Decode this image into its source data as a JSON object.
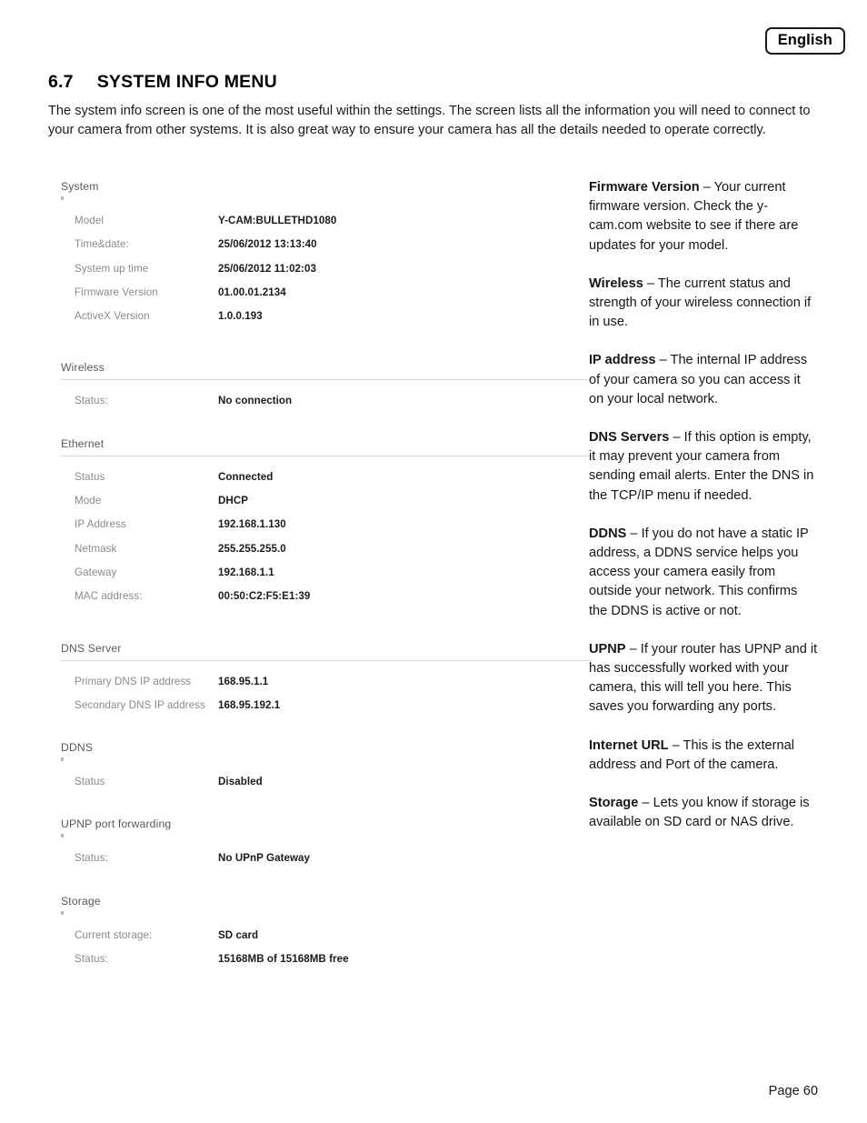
{
  "language_badge": "English",
  "heading": {
    "number": "6.7",
    "title": "SYSTEM INFO MENU"
  },
  "intro": "The system info screen is one of the most useful within the settings.  The screen lists all the information you will need to connect to your camera from other systems. It is also great way to ensure your camera has all the details needed to operate correctly.",
  "screenshot": {
    "sections": [
      {
        "title": "System",
        "rule": false,
        "rows": [
          {
            "label": "Model",
            "value": "Y-CAM:BULLETHD1080"
          },
          {
            "label": "Time&date:",
            "value": "25/06/2012 13:13:40"
          },
          {
            "label": "System up time",
            "value": "25/06/2012 11:02:03"
          },
          {
            "label": "Firmware Version",
            "value": "01.00.01.2134"
          },
          {
            "label": "ActiveX Version",
            "value": "1.0.0.193"
          }
        ]
      },
      {
        "title": "Wireless",
        "rule": true,
        "rows": [
          {
            "label": "Status:",
            "value": "No connection"
          }
        ]
      },
      {
        "title": "Ethernet",
        "rule": true,
        "rows": [
          {
            "label": "Status",
            "value": "Connected"
          },
          {
            "label": "Mode",
            "value": "DHCP"
          },
          {
            "label": "IP Address",
            "value": "192.168.1.130"
          },
          {
            "label": "Netmask",
            "value": "255.255.255.0"
          },
          {
            "label": "Gateway",
            "value": "192.168.1.1"
          },
          {
            "label": "MAC address:",
            "value": "00:50:C2:F5:E1:39"
          }
        ]
      },
      {
        "title": "DNS Server",
        "rule": true,
        "rows": [
          {
            "label": "Primary DNS IP address",
            "value": "168.95.1.1"
          },
          {
            "label": "Secondary DNS IP address",
            "value": "168.95.192.1"
          }
        ]
      },
      {
        "title": "DDNS",
        "rule": false,
        "rows": [
          {
            "label": "Status",
            "value": "Disabled"
          }
        ]
      },
      {
        "title": "UPNP port forwarding",
        "rule": false,
        "rows": [
          {
            "label": "Status:",
            "value": "No UPnP Gateway"
          }
        ]
      },
      {
        "title": "Storage",
        "rule": false,
        "rows": [
          {
            "label": "Current storage:",
            "value": "SD card"
          },
          {
            "label": "Status:",
            "value": "15168MB of 15168MB free"
          }
        ]
      }
    ]
  },
  "notes": [
    {
      "term": "Firmware Version",
      "body": " – Your current firmware version.  Check the y-cam.com website to see if there are updates for your model."
    },
    {
      "term": "Wireless",
      "body": " – The current status and strength of your wireless connection if in use."
    },
    {
      "term": "IP address",
      "body": " – The internal IP address of your camera so you can access it on your local network."
    },
    {
      "term": "DNS Servers",
      "body": " – If this option is empty, it may prevent your camera from sending email alerts.  Enter the DNS in the TCP/IP menu if needed."
    },
    {
      "term": "DDNS",
      "body": " – If you do not have a static IP address, a DDNS service helps you access your camera easily from outside your network.  This confirms the DDNS is active or not."
    },
    {
      "term": "UPNP",
      "body": " – If your router has UPNP and it has successfully worked with your camera, this will tell you here. This saves you forwarding any ports."
    },
    {
      "term": "Internet URL",
      "body": " – This is the external address and Port of the camera."
    },
    {
      "term": "Storage",
      "body": " – Lets you know if storage is available on SD card or NAS drive."
    }
  ],
  "footer": "Page 60"
}
